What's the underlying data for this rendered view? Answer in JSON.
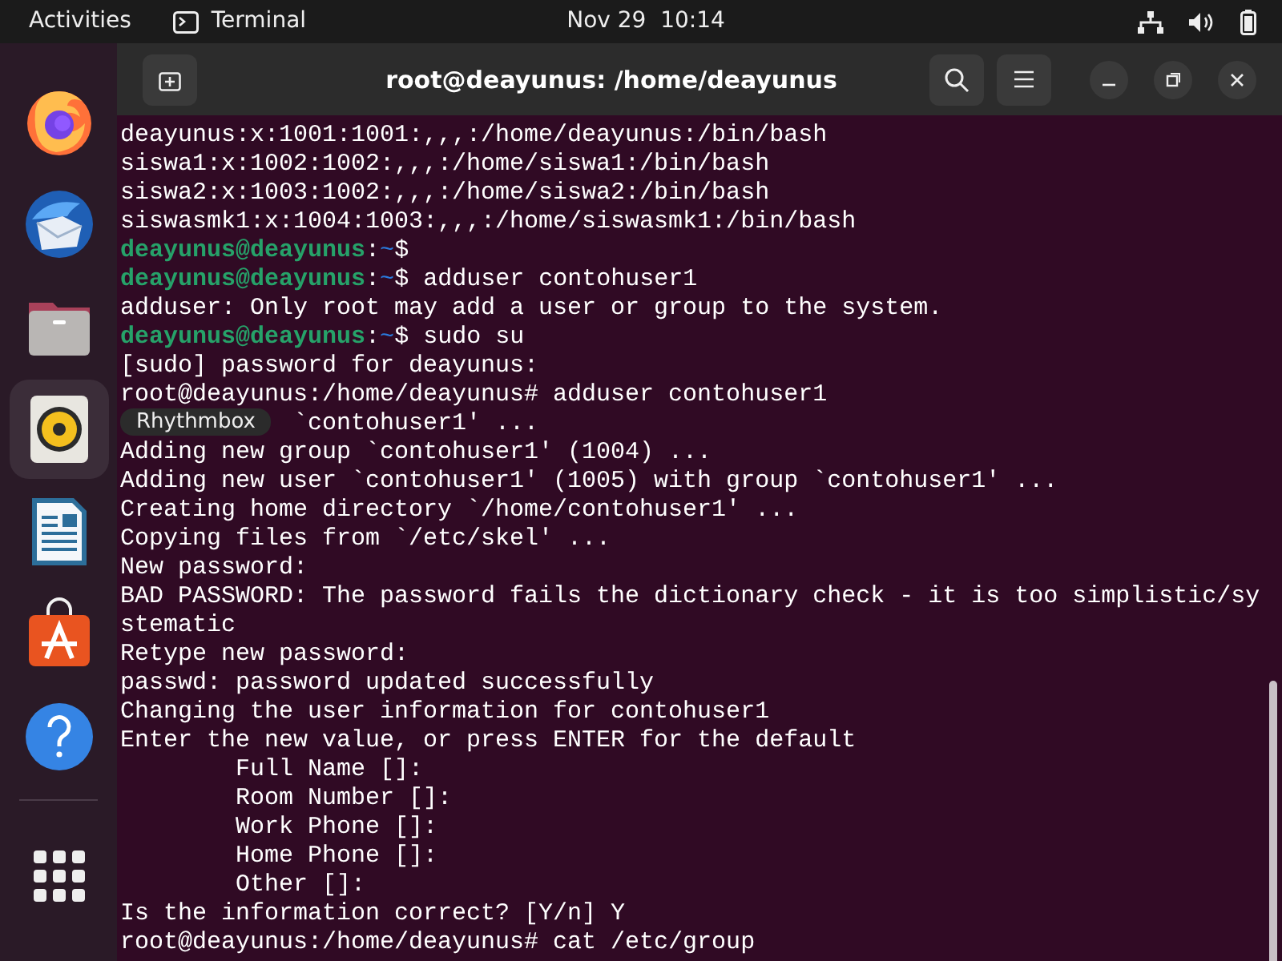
{
  "top_bar": {
    "activities": "Activities",
    "app_name": "Terminal",
    "clock": "Nov 29  10:14"
  },
  "dock": {
    "items": [
      {
        "kind": "firefox",
        "selected": false
      },
      {
        "kind": "thunderbird",
        "selected": false
      },
      {
        "kind": "files",
        "selected": false
      },
      {
        "kind": "rhythmbox",
        "selected": true
      },
      {
        "kind": "writer",
        "selected": false
      },
      {
        "kind": "software",
        "selected": false
      },
      {
        "kind": "help",
        "selected": false
      }
    ],
    "tooltip": "Rhythmbox"
  },
  "window": {
    "title": "root@deayunus: /home/deayunus"
  },
  "terminal": {
    "lines": [
      {
        "kind": "text",
        "text": "deayunus:x:1001:1001:,,,:/home/deayunus:/bin/bash"
      },
      {
        "kind": "text",
        "text": "siswa1:x:1002:1002:,,,:/home/siswa1:/bin/bash"
      },
      {
        "kind": "text",
        "text": "siswa2:x:1003:1002:,,,:/home/siswa2:/bin/bash"
      },
      {
        "kind": "text",
        "text": "siswasmk1:x:1004:1003:,,,:/home/siswasmk1:/bin/bash"
      },
      {
        "kind": "prompt",
        "user": "deayunus@deayunus",
        "colon": ":",
        "path": "~",
        "rest": "$"
      },
      {
        "kind": "prompt",
        "user": "deayunus@deayunus",
        "colon": ":",
        "path": "~",
        "rest": "$ adduser contohuser1"
      },
      {
        "kind": "text",
        "text": "adduser: Only root may add a user or group to the system."
      },
      {
        "kind": "prompt",
        "user": "deayunus@deayunus",
        "colon": ":",
        "path": "~",
        "rest": "$ sudo su"
      },
      {
        "kind": "text",
        "text": "[sudo] password for deayunus:"
      },
      {
        "kind": "text",
        "text": "root@deayunus:/home/deayunus# adduser contohuser1"
      },
      {
        "kind": "covered",
        "text": "`contohuser1' ..."
      },
      {
        "kind": "text",
        "text": "Adding new group `contohuser1' (1004) ..."
      },
      {
        "kind": "text",
        "text": "Adding new user `contohuser1' (1005) with group `contohuser1' ..."
      },
      {
        "kind": "text",
        "text": "Creating home directory `/home/contohuser1' ..."
      },
      {
        "kind": "text",
        "text": "Copying files from `/etc/skel' ..."
      },
      {
        "kind": "text",
        "text": "New password:"
      },
      {
        "kind": "text",
        "text": "BAD PASSWORD: The password fails the dictionary check - it is too simplistic/sy"
      },
      {
        "kind": "text",
        "text": "stematic"
      },
      {
        "kind": "text",
        "text": "Retype new password:"
      },
      {
        "kind": "text",
        "text": "passwd: password updated successfully"
      },
      {
        "kind": "text",
        "text": "Changing the user information for contohuser1"
      },
      {
        "kind": "text",
        "text": "Enter the new value, or press ENTER for the default"
      },
      {
        "kind": "indented",
        "text": "Full Name []:"
      },
      {
        "kind": "indented",
        "text": "Room Number []:"
      },
      {
        "kind": "indented",
        "text": "Work Phone []:"
      },
      {
        "kind": "indented",
        "text": "Home Phone []:"
      },
      {
        "kind": "indented",
        "text": "Other []:"
      },
      {
        "kind": "text",
        "text": "Is the information correct? [Y/n] Y"
      },
      {
        "kind": "text",
        "text": "root@deayunus:/home/deayunus# cat /etc/group"
      }
    ]
  }
}
